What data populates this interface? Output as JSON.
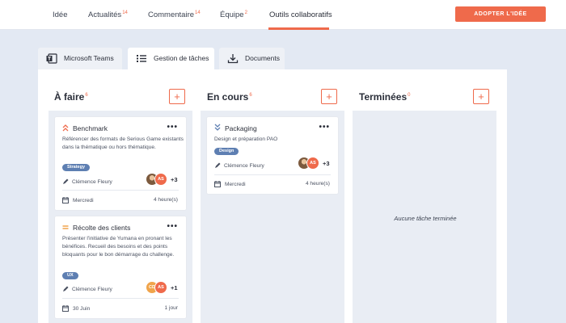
{
  "topnav": {
    "items": [
      {
        "label": "Idée",
        "count": ""
      },
      {
        "label": "Actualités",
        "count": "14"
      },
      {
        "label": "Commentaire",
        "count": "14"
      },
      {
        "label": "Équipe",
        "count": "2"
      },
      {
        "label": "Outils collaboratifs",
        "count": ""
      }
    ],
    "active": "Outils collaboratifs",
    "cta": "ADOPTER L'IDÉE"
  },
  "tabs": [
    {
      "label": "Microsoft Teams",
      "icon": "teams-icon",
      "active": false
    },
    {
      "label": "Gestion de tâches",
      "icon": "list-icon",
      "active": true
    },
    {
      "label": "Documents",
      "icon": "download-icon",
      "active": false
    }
  ],
  "columns": [
    {
      "title": "À faire",
      "count": "6",
      "add": "+",
      "cards": [
        {
          "title": "Benchmark",
          "priority": "high",
          "menu": "•••",
          "description": "Référencer des formats de Serious Game existants dans la thématique ou hors thématique.",
          "tag": "Strategy",
          "assignee": "Clémence Fleury",
          "avatars": [
            {
              "initials": "",
              "style": "photo"
            },
            {
              "initials": "AS",
              "style": "orange"
            }
          ],
          "extra": "+3",
          "date": "Mercredi",
          "duration": "4 heure(s)"
        },
        {
          "title": "Récolte des clients",
          "priority": "medium",
          "menu": "•••",
          "description": "Présenter l'initiative de Yumana en pronant les bénéfices. Recueil des besoins et des points bloquants pour le bon démarrage du challenge.",
          "tag": "UX",
          "assignee": "Clémence Fleury",
          "avatars": [
            {
              "initials": "CD",
              "style": "gold"
            },
            {
              "initials": "AS",
              "style": "orange"
            }
          ],
          "extra": "+1",
          "date": "30 Juin",
          "duration": "1 jour"
        }
      ]
    },
    {
      "title": "En cours",
      "count": "6",
      "add": "+",
      "cards": [
        {
          "title": "Packaging",
          "priority": "low",
          "menu": "•••",
          "description": "Design et préparation PAO",
          "tag": "Design",
          "assignee": "Clémence Fleury",
          "avatars": [
            {
              "initials": "",
              "style": "photo"
            },
            {
              "initials": "AS",
              "style": "orange"
            }
          ],
          "extra": "+3",
          "date": "Mercredi",
          "duration": "4 heure(s)"
        }
      ]
    },
    {
      "title": "Terminées",
      "count": "0",
      "add": "+",
      "empty": "Aucune tâche terminée",
      "cards": []
    }
  ],
  "colors": {
    "accent": "#ef6a4b",
    "tag": "#5e7fb2",
    "background": "#e3e9f3",
    "lane": "#e9edf4"
  }
}
